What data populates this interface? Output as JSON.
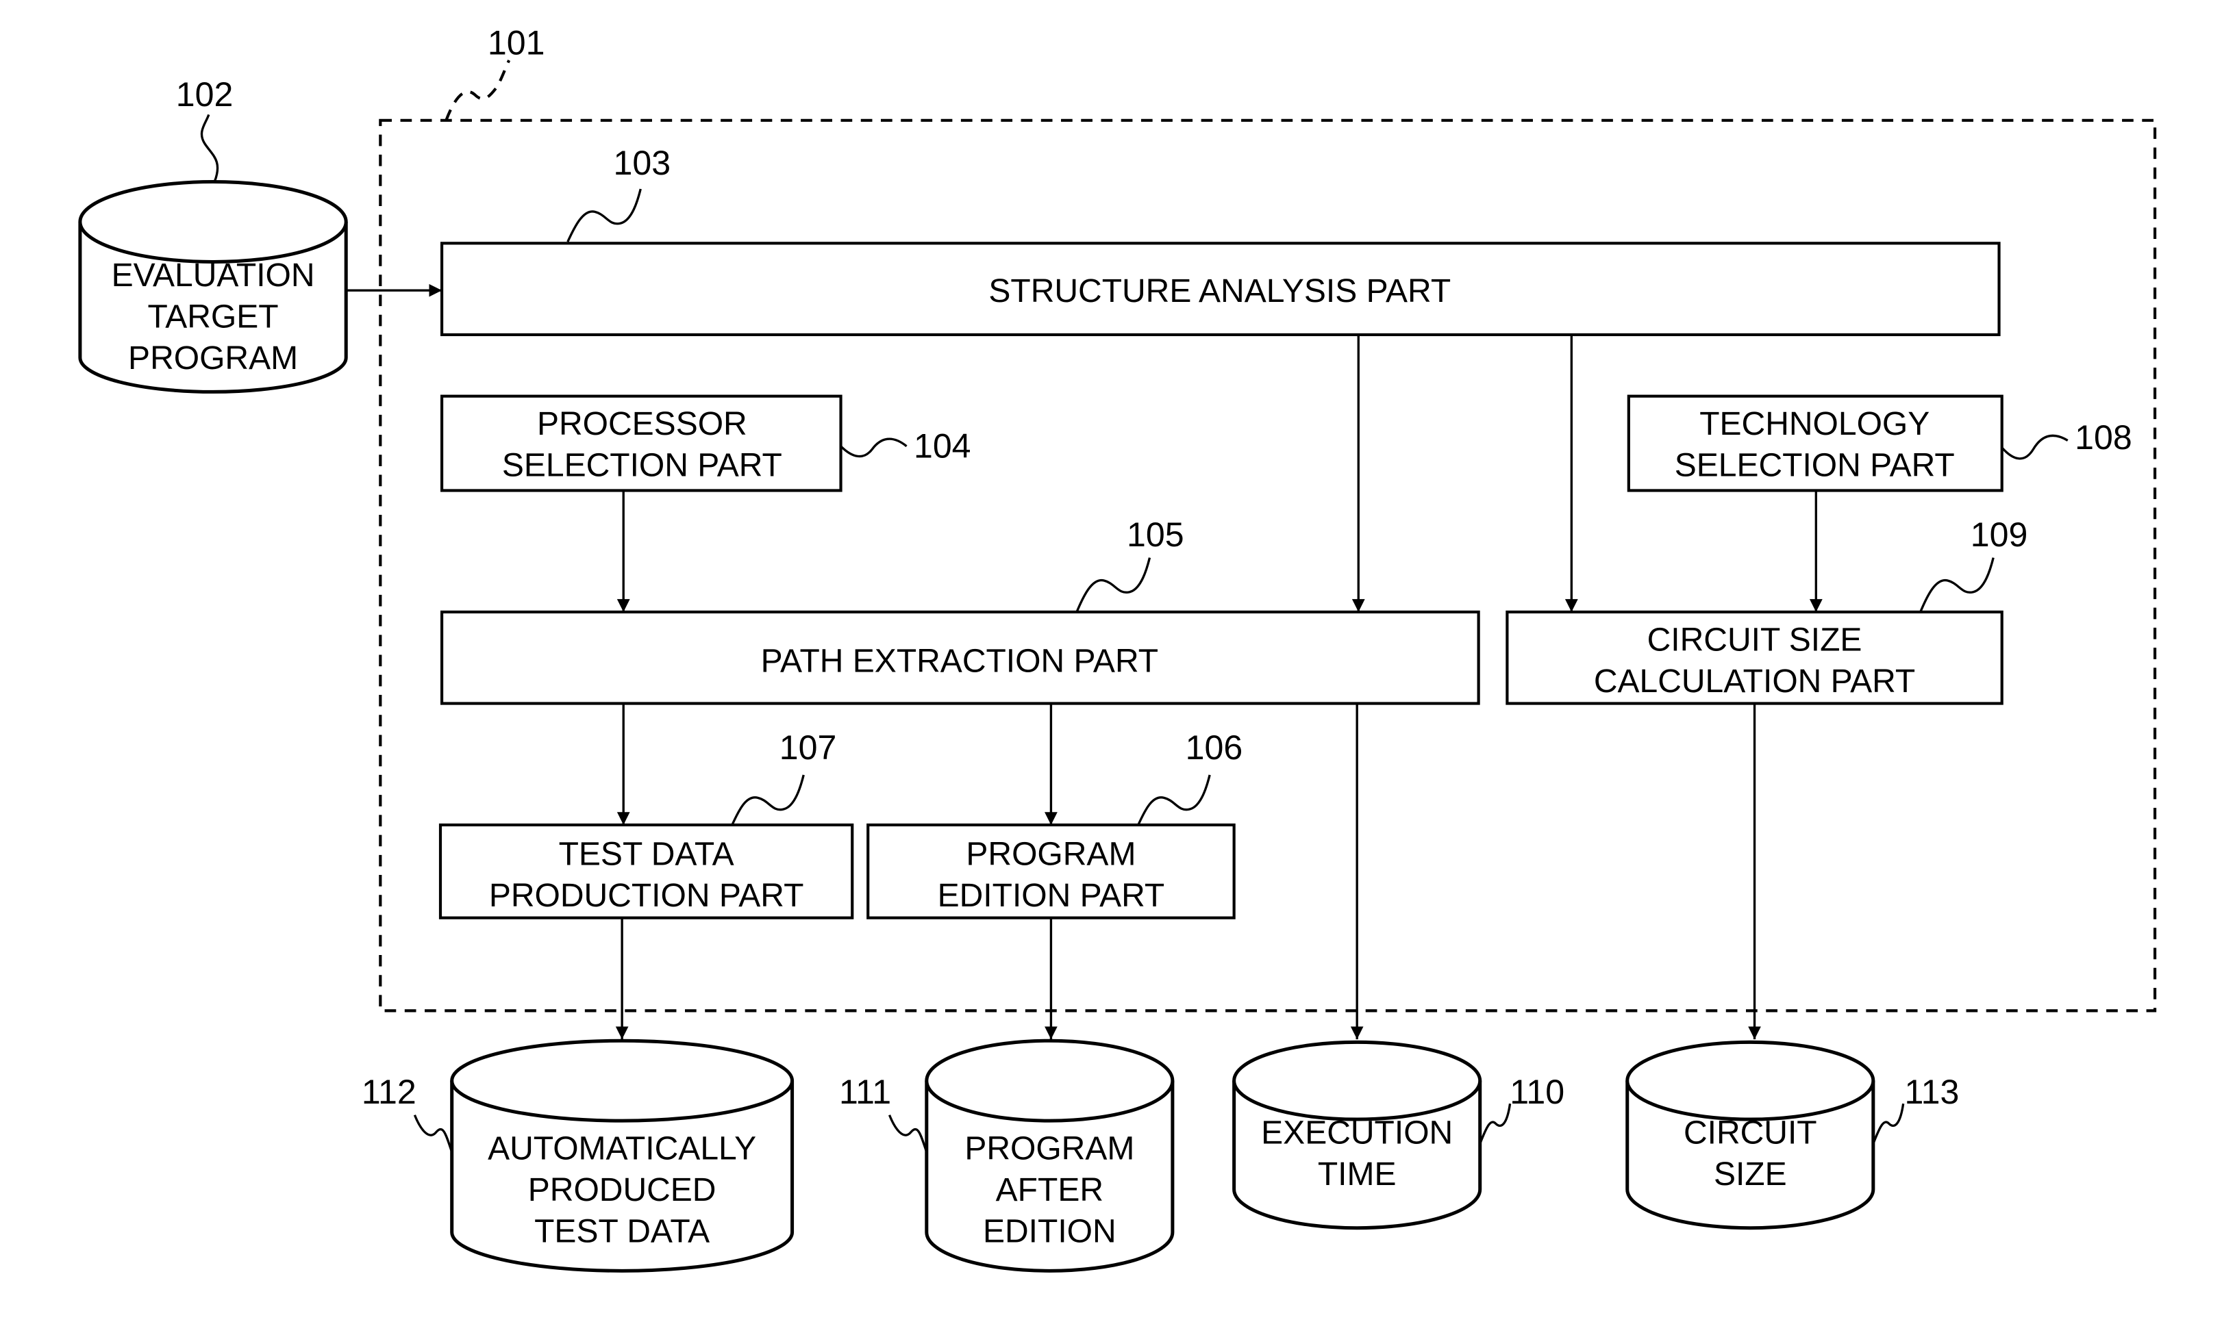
{
  "figure": {
    "system": {
      "ref": "101"
    },
    "input_store": {
      "ref": "102",
      "lines": [
        "EVALUATION",
        "TARGET",
        "PROGRAM"
      ]
    },
    "blocks": {
      "structure_analysis": {
        "ref": "103",
        "lines": [
          "STRUCTURE ANALYSIS PART"
        ]
      },
      "processor_selection": {
        "ref": "104",
        "lines": [
          "PROCESSOR",
          "SELECTION PART"
        ]
      },
      "path_extraction": {
        "ref": "105",
        "lines": [
          "PATH EXTRACTION PART"
        ]
      },
      "program_edition": {
        "ref": "106",
        "lines": [
          "PROGRAM",
          "EDITION PART"
        ]
      },
      "test_data_production": {
        "ref": "107",
        "lines": [
          "TEST DATA",
          "PRODUCTION PART"
        ]
      },
      "technology_selection": {
        "ref": "108",
        "lines": [
          "TECHNOLOGY",
          "SELECTION PART"
        ]
      },
      "circuit_size_calculation": {
        "ref": "109",
        "lines": [
          "CIRCUIT SIZE",
          "CALCULATION PART"
        ]
      }
    },
    "outputs": {
      "execution_time": {
        "ref": "110",
        "lines": [
          "EXECUTION",
          "TIME"
        ]
      },
      "program_after_edition": {
        "ref": "111",
        "lines": [
          "PROGRAM",
          "AFTER",
          "EDITION"
        ]
      },
      "test_data": {
        "ref": "112",
        "lines": [
          "AUTOMATICALLY",
          "PRODUCED",
          "TEST DATA"
        ]
      },
      "circuit_size": {
        "ref": "113",
        "lines": [
          "CIRCUIT",
          "SIZE"
        ]
      }
    },
    "connections": [
      {
        "from": "102",
        "to": "103"
      },
      {
        "from": "103",
        "to": "105"
      },
      {
        "from": "103",
        "to": "109"
      },
      {
        "from": "104",
        "to": "105"
      },
      {
        "from": "108",
        "to": "109"
      },
      {
        "from": "105",
        "to": "107"
      },
      {
        "from": "105",
        "to": "106"
      },
      {
        "from": "105",
        "to": "110"
      },
      {
        "from": "107",
        "to": "112"
      },
      {
        "from": "106",
        "to": "111"
      },
      {
        "from": "109",
        "to": "113"
      }
    ]
  }
}
